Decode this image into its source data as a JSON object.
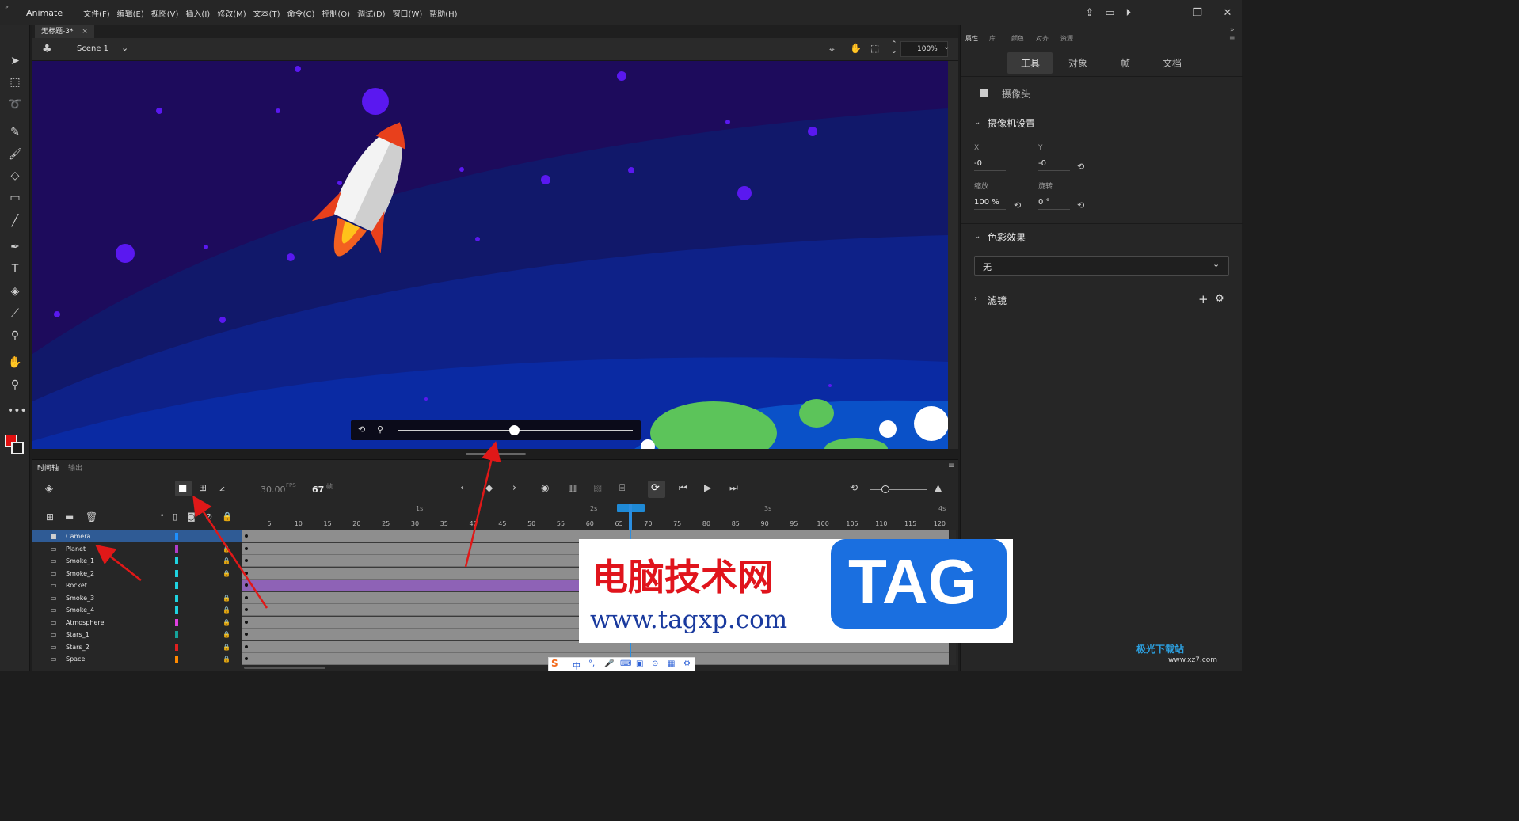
{
  "menubar": {
    "app_name": "Animate",
    "items": [
      "文件(F)",
      "编辑(E)",
      "视图(V)",
      "插入(I)",
      "修改(M)",
      "文本(T)",
      "命令(C)",
      "控制(O)",
      "调试(D)",
      "窗口(W)",
      "帮助(H)"
    ]
  },
  "document": {
    "tab_title": "无标题-3*",
    "close_glyph": "×"
  },
  "scene": {
    "name": "Scene 1",
    "zoom": "100%"
  },
  "timeline": {
    "tabs": [
      "时间轴",
      "输出"
    ],
    "fps": "30.00",
    "fps_unit": "FPS",
    "current_frame": "67",
    "frame_unit": "帧",
    "seconds": [
      "1s",
      "2s",
      "3s",
      "4s"
    ],
    "ruler": [
      "5",
      "10",
      "15",
      "20",
      "25",
      "30",
      "35",
      "40",
      "45",
      "50",
      "55",
      "60",
      "65",
      "70",
      "75",
      "80",
      "85",
      "90",
      "95",
      "100",
      "105",
      "110",
      "115",
      "120"
    ],
    "layers": [
      {
        "name": "Camera",
        "color": "#1e90ff",
        "locked": false,
        "selected": true
      },
      {
        "name": "Planet",
        "color": "#b03cc8",
        "locked": true
      },
      {
        "name": "Smoke_1",
        "color": "#1fd3e0",
        "locked": true
      },
      {
        "name": "Smoke_2",
        "color": "#1fd3e0",
        "locked": true
      },
      {
        "name": "Rocket",
        "color": "#1fd3e0",
        "locked": false
      },
      {
        "name": "Smoke_3",
        "color": "#1fd3e0",
        "locked": true
      },
      {
        "name": "Smoke_4",
        "color": "#1fd3e0",
        "locked": true
      },
      {
        "name": "Atmosphere",
        "color": "#e040e0",
        "locked": true
      },
      {
        "name": "Stars_1",
        "color": "#16a39a",
        "locked": true
      },
      {
        "name": "Stars_2",
        "color": "#e02020",
        "locked": true
      },
      {
        "name": "Space",
        "color": "#ff8a00",
        "locked": true
      }
    ]
  },
  "properties": {
    "tabs": [
      "属性",
      "库",
      "颜色",
      "对齐",
      "资源"
    ],
    "subtabs": [
      "工具",
      "对象",
      "帧",
      "文档"
    ],
    "tool_name": "摄像头",
    "camera_section": "摄像机设置",
    "x_label": "X",
    "x_value": "-0",
    "y_label": "Y",
    "y_value": "-0",
    "scale_label": "缩放",
    "scale_value": "100 %",
    "rotate_label": "旋转",
    "rotate_value": "0 °",
    "color_section": "色彩效果",
    "color_value": "无",
    "filter_section": "滤镜"
  },
  "watermark": {
    "title": "电脑技术网",
    "url": "www.tagxp.com",
    "badge": "TAG"
  },
  "corner_logo": {
    "text": "极光下载站",
    "url": "www.xz7.com"
  },
  "ime": {
    "items": [
      "中",
      "°,",
      "🎤",
      "⌨",
      "👕",
      "⊙",
      "▦",
      "⚙"
    ]
  }
}
